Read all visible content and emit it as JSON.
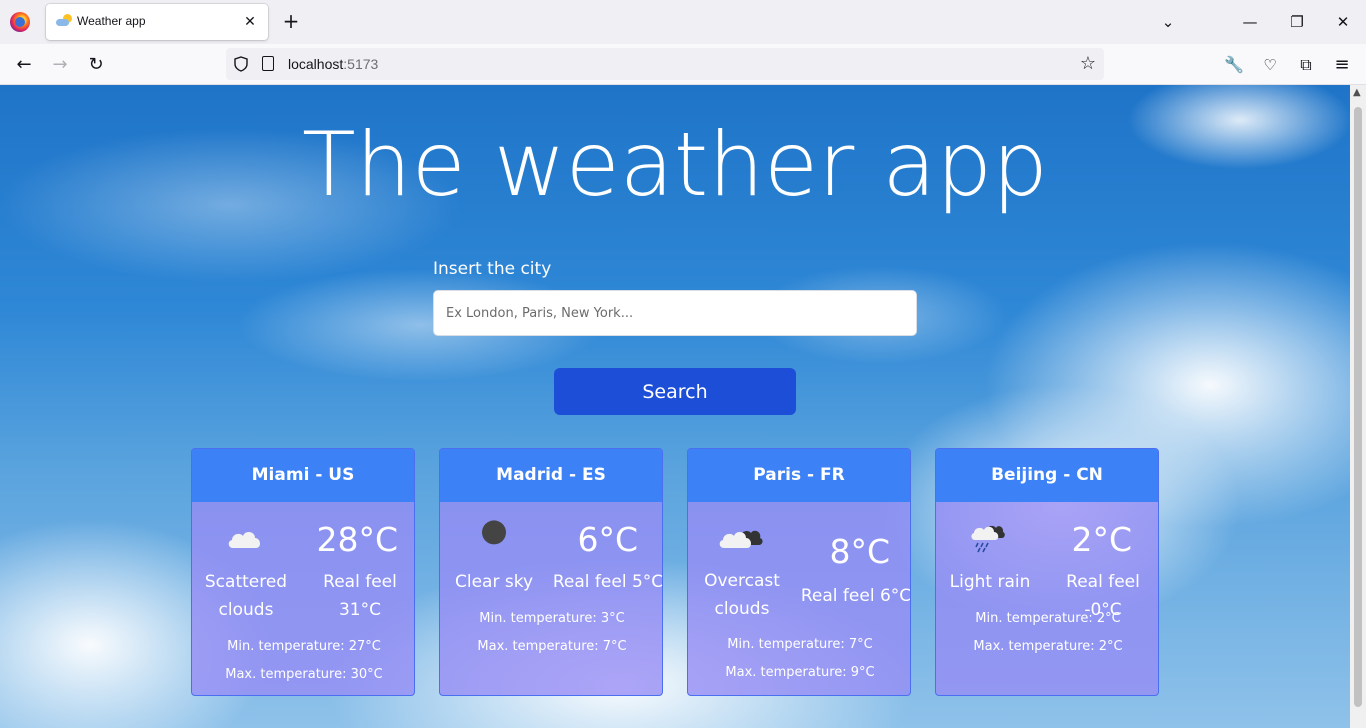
{
  "browser": {
    "tab_title": "Weather app",
    "url_host": "localhost",
    "url_port": ":5173"
  },
  "page": {
    "title": "The weather app",
    "input_label": "Insert the city",
    "input_placeholder": "Ex London, Paris, New York...",
    "search_label": "Search"
  },
  "cards": [
    {
      "city": "Miami - US",
      "icon": "scattered-clouds-icon",
      "temperature": "28°C",
      "description": [
        "Scattered",
        "clouds"
      ],
      "real_feel": [
        "Real feel",
        "31°C"
      ],
      "min_temp": "Min. temperature: 27°C",
      "max_temp": "Max. temperature: 30°C"
    },
    {
      "city": "Madrid - ES",
      "icon": "clear-sky-icon",
      "temperature": "6°C",
      "description": [
        "Clear sky"
      ],
      "real_feel": [
        "Real feel 5°C"
      ],
      "min_temp": "Min. temperature: 3°C",
      "max_temp": "Max. temperature: 7°C"
    },
    {
      "city": "Paris - FR",
      "icon": "overcast-clouds-icon",
      "temperature": "8°C",
      "description": [
        "Overcast",
        "clouds"
      ],
      "real_feel": [
        "Real feel 6°C"
      ],
      "min_temp": "Min. temperature: 7°C",
      "max_temp": "Max. temperature: 9°C"
    },
    {
      "city": "Beijing - CN",
      "icon": "light-rain-icon",
      "temperature": "2°C",
      "description": [
        "Light rain"
      ],
      "real_feel": [
        "Real feel -0°C"
      ],
      "min_temp": "Min. temperature: 2°C",
      "max_temp": "Max. temperature: 2°C"
    }
  ]
}
